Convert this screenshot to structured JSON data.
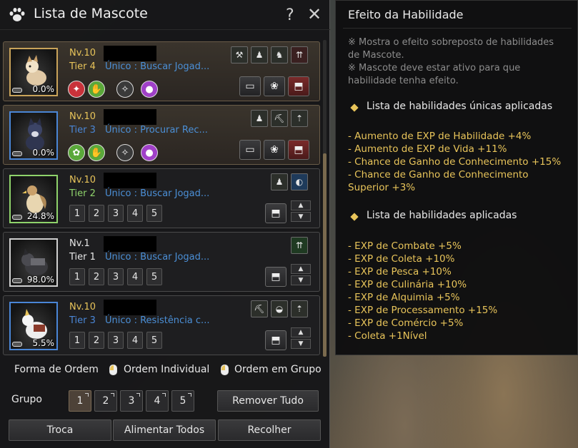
{
  "window": {
    "title": "Lista de Mascote",
    "help": "?",
    "close": "✕"
  },
  "pets": [
    {
      "level": "Nv.10",
      "tier": "Tier 4",
      "skill": "Único : Buscar Jogad...",
      "hunger": "0.0%",
      "actions": [
        "feed",
        "paw",
        "release"
      ]
    },
    {
      "level": "Nv.10",
      "tier": "Tier 3",
      "skill": "Único : Procurar Rec...",
      "hunger": "0.0%",
      "actions": [
        "feed",
        "paw",
        "release"
      ]
    },
    {
      "level": "Nv.10",
      "tier": "Tier 2",
      "skill": "Único : Buscar Jogad...",
      "hunger": "24.8%",
      "numbers": [
        "1",
        "2",
        "3",
        "4",
        "5"
      ]
    },
    {
      "level": "Nv.1",
      "tier": "Tier 1",
      "skill": "Único : Buscar Jogad...",
      "hunger": "98.0%",
      "numbers": [
        "1",
        "2",
        "3",
        "4",
        "5"
      ]
    },
    {
      "level": "Nv.10",
      "tier": "Tier 3",
      "skill": "Único : Resistência c...",
      "hunger": "5.5%",
      "numbers": [
        "1",
        "2",
        "3",
        "4",
        "5"
      ]
    }
  ],
  "order": {
    "label": "Forma de Ordem",
    "individual": "Ordem Individual",
    "group": "Ordem em Grupo"
  },
  "group": {
    "label": "Grupo",
    "buttons": [
      "1",
      "2",
      "3",
      "4",
      "5"
    ],
    "remove_all": "Remover Tudo"
  },
  "footer": {
    "swap": "Troca",
    "feed_all": "Alimentar Todos",
    "collect": "Recolher"
  },
  "tooltip": {
    "title": "Efeito da Habilidade",
    "note1": "※ Mostra o efeito sobreposto de habilidades de Mascote.",
    "note2": "※ Mascote deve estar ativo para que habilidade tenha efeito.",
    "unique_header": "Lista de habilidades únicas aplicadas",
    "unique_effects": [
      "- Aumento de EXP de Habilidade +4%",
      "- Aumento de EXP de Vida +11%",
      "- Chance de Ganho de Conhecimento +15%",
      "- Chance de Ganho de Conhecimento Superior +3%"
    ],
    "applied_header": "Lista de habilidades aplicadas",
    "applied_effects": [
      "- EXP de Combate +5%",
      "- EXP de Coleta +10%",
      "- EXP de Pesca +10%",
      "- EXP de Culinária +10%",
      "- EXP de Alquimia +5%",
      "- EXP de Processamento +15%",
      "- EXP de Comércio +5%",
      "- Coleta +1Nível"
    ]
  }
}
